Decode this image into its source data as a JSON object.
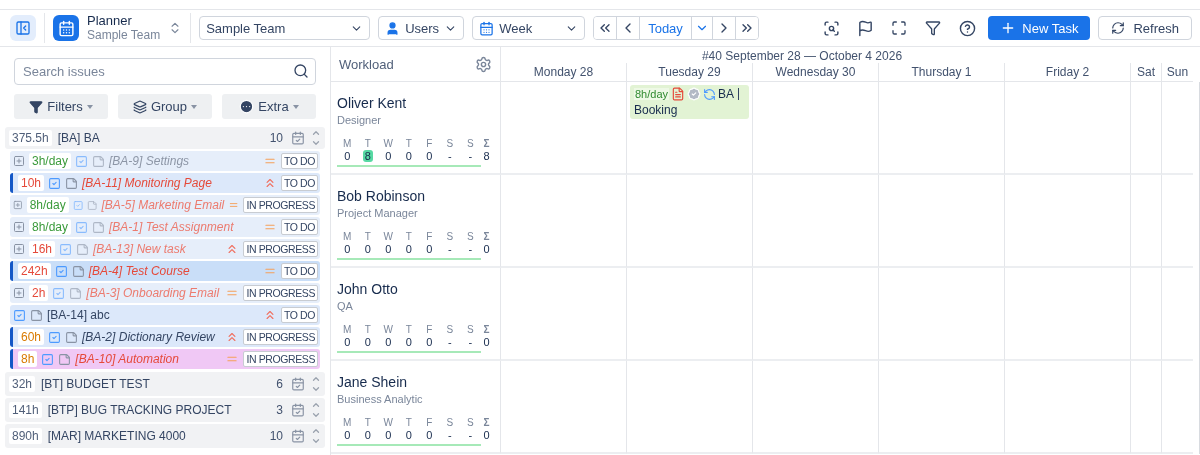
{
  "toolbar": {
    "app": {
      "title": "Planner",
      "subtitle": "Sample Team"
    },
    "selects": [
      {
        "kind": "plain",
        "value": "Sample Team"
      },
      {
        "kind": "user",
        "value": "Users"
      },
      {
        "kind": "calendar",
        "value": "Week"
      }
    ],
    "today": "Today",
    "new_task": "New Task",
    "refresh": "Refresh"
  },
  "sidebar": {
    "search": {
      "placeholder": "Search issues"
    },
    "buttons": [
      {
        "kind": "filter",
        "label": "Filters"
      },
      {
        "kind": "group",
        "label": "Group"
      },
      {
        "kind": "extra",
        "label": "Extra"
      }
    ],
    "groups": [
      {
        "hours": "375.5h",
        "title": "[BA] BA",
        "count": "10",
        "expanded": true,
        "children": [
          {
            "expandable": true,
            "hours": {
              "text": "3h/day",
              "color": "#3a9a3a"
            },
            "title": {
              "text": "[BA-9] Settings",
              "color": "#8d96a6"
            },
            "italic": true,
            "faded": true,
            "high_priority": false,
            "status": "TO DO",
            "selected": false,
            "color": "#e6eefa"
          },
          {
            "expandable": false,
            "hours": {
              "text": "10h",
              "color": "#e5493a"
            },
            "title": {
              "text": "[BA-11] Monitoring Page",
              "color": "#e5493a"
            },
            "italic": true,
            "faded": false,
            "high_priority": true,
            "status": "TO DO",
            "selected": true,
            "color": "#dce8fa"
          },
          {
            "expandable": true,
            "hours": {
              "text": "8h/day",
              "color": "#3a9a3a"
            },
            "title": {
              "text": "[BA-5] Marketing Email",
              "color": "#ec7b6f"
            },
            "italic": true,
            "faded": true,
            "high_priority": false,
            "status": "IN PROGRESS",
            "selected": false,
            "color": "#e6eefa"
          },
          {
            "expandable": true,
            "hours": {
              "text": "8h/day",
              "color": "#3a9a3a"
            },
            "title": {
              "text": "[BA-1] Test Assignment",
              "color": "#ec7b6f"
            },
            "italic": true,
            "faded": true,
            "high_priority": false,
            "status": "TO DO",
            "selected": false,
            "color": "#e6eefa"
          },
          {
            "expandable": true,
            "hours": {
              "text": "16h",
              "color": "#e5493a"
            },
            "title": {
              "text": "[BA-13] New task",
              "color": "#ec7b6f"
            },
            "italic": true,
            "faded": true,
            "high_priority": true,
            "status": "IN PROGRESS",
            "selected": false,
            "color": "#e6eefa"
          },
          {
            "expandable": false,
            "hours": {
              "text": "242h",
              "color": "#e5493a"
            },
            "title": {
              "text": "[BA-4] Test Course",
              "color": "#e5493a"
            },
            "italic": true,
            "faded": false,
            "high_priority": false,
            "status": "TO DO",
            "selected": true,
            "color": "#c9def8"
          },
          {
            "expandable": true,
            "hours": {
              "text": "2h",
              "color": "#e5493a"
            },
            "title": {
              "text": "[BA-3] Onboarding Email",
              "color": "#ec7b6f"
            },
            "italic": true,
            "faded": true,
            "high_priority": false,
            "status": "IN PROGRESS",
            "selected": false,
            "color": "#e6eefa"
          },
          {
            "expandable": false,
            "title": {
              "text": "[BA-14] abc",
              "color": "#344563"
            },
            "italic": false,
            "faded": false,
            "high_priority": true,
            "status": "TO DO",
            "selected": false,
            "color": "#dce8fa"
          },
          {
            "expandable": false,
            "hours": {
              "text": "60h",
              "color": "#d97a00"
            },
            "title": {
              "text": "[BA-2] Dictionary Review",
              "color": "#344563"
            },
            "italic": true,
            "faded": false,
            "high_priority": true,
            "status": "IN PROGRESS",
            "selected": true,
            "color": "#dce8fa"
          },
          {
            "expandable": false,
            "hours": {
              "text": "8h",
              "color": "#d97a00"
            },
            "title": {
              "text": "[BA-10] Automation",
              "color": "#e5493a"
            },
            "italic": true,
            "faded": false,
            "high_priority": false,
            "status": "IN PROGRESS",
            "selected": true,
            "color": "#f0c8f5"
          }
        ]
      },
      {
        "hours": "32h",
        "title": "[BT] BUDGET TEST",
        "count": "6",
        "expanded": false
      },
      {
        "hours": "141h",
        "title": "[BTP] BUG TRACKING PROJECT",
        "count": "3",
        "expanded": false
      },
      {
        "hours": "890h",
        "title": "[MAR] MARKETING 4000",
        "count": "10",
        "expanded": false
      }
    ]
  },
  "calendar": {
    "workload_title": "Workload",
    "week_title": "#40 September 28 — October 4 2026",
    "days": [
      {
        "label": "Monday 28",
        "weekend": false
      },
      {
        "label": "Tuesday 29",
        "weekend": false
      },
      {
        "label": "Wednesday 30",
        "weekend": false
      },
      {
        "label": "Thursday 1",
        "weekend": false
      },
      {
        "label": "Friday 2",
        "weekend": false
      },
      {
        "label": "Sat",
        "weekend": true
      },
      {
        "label": "Sun",
        "weekend": true
      }
    ],
    "people": [
      {
        "name": "Oliver Kent",
        "role": "Designer",
        "sum_label": "Σ",
        "sum": "8",
        "days": [
          {
            "label": "M",
            "value": "0",
            "highlighted": false
          },
          {
            "label": "T",
            "value": "8",
            "highlighted": true
          },
          {
            "label": "W",
            "value": "0",
            "highlighted": false
          },
          {
            "label": "T",
            "value": "0",
            "highlighted": false
          },
          {
            "label": "F",
            "value": "0",
            "highlighted": false
          },
          {
            "label": "S",
            "value": "-",
            "highlighted": false
          },
          {
            "label": "S",
            "value": "-",
            "highlighted": false
          }
        ],
        "cells": [
          {},
          {
            "bookings": [
              {
                "hours": "8h/day",
                "project": "BA",
                "title": "Booking"
              }
            ]
          },
          {},
          {},
          {},
          {},
          {}
        ]
      },
      {
        "name": "Bob Robinson",
        "role": "Project Manager",
        "sum_label": "Σ",
        "sum": "0",
        "days": [
          {
            "label": "M",
            "value": "0",
            "highlighted": false
          },
          {
            "label": "T",
            "value": "0",
            "highlighted": false
          },
          {
            "label": "W",
            "value": "0",
            "highlighted": false
          },
          {
            "label": "T",
            "value": "0",
            "highlighted": false
          },
          {
            "label": "F",
            "value": "0",
            "highlighted": false
          },
          {
            "label": "S",
            "value": "-",
            "highlighted": false
          },
          {
            "label": "S",
            "value": "-",
            "highlighted": false
          }
        ],
        "cells": [
          {},
          {},
          {},
          {},
          {},
          {},
          {}
        ]
      },
      {
        "name": "John Otto",
        "role": "QA",
        "sum_label": "Σ",
        "sum": "0",
        "days": [
          {
            "label": "M",
            "value": "0",
            "highlighted": false
          },
          {
            "label": "T",
            "value": "0",
            "highlighted": false
          },
          {
            "label": "W",
            "value": "0",
            "highlighted": false
          },
          {
            "label": "T",
            "value": "0",
            "highlighted": false
          },
          {
            "label": "F",
            "value": "0",
            "highlighted": false
          },
          {
            "label": "S",
            "value": "-",
            "highlighted": false
          },
          {
            "label": "S",
            "value": "-",
            "highlighted": false
          }
        ],
        "cells": [
          {},
          {},
          {},
          {},
          {},
          {},
          {}
        ]
      },
      {
        "name": "Jane Shein",
        "role": "Business Analytic",
        "sum_label": "Σ",
        "sum": "0",
        "days": [
          {
            "label": "M",
            "value": "0",
            "highlighted": false
          },
          {
            "label": "T",
            "value": "0",
            "highlighted": false
          },
          {
            "label": "W",
            "value": "0",
            "highlighted": false
          },
          {
            "label": "T",
            "value": "0",
            "highlighted": false
          },
          {
            "label": "F",
            "value": "0",
            "highlighted": false
          },
          {
            "label": "S",
            "value": "-",
            "highlighted": false
          },
          {
            "label": "S",
            "value": "-",
            "highlighted": false
          }
        ],
        "cells": [
          {},
          {},
          {},
          {},
          {},
          {},
          {}
        ]
      }
    ]
  }
}
